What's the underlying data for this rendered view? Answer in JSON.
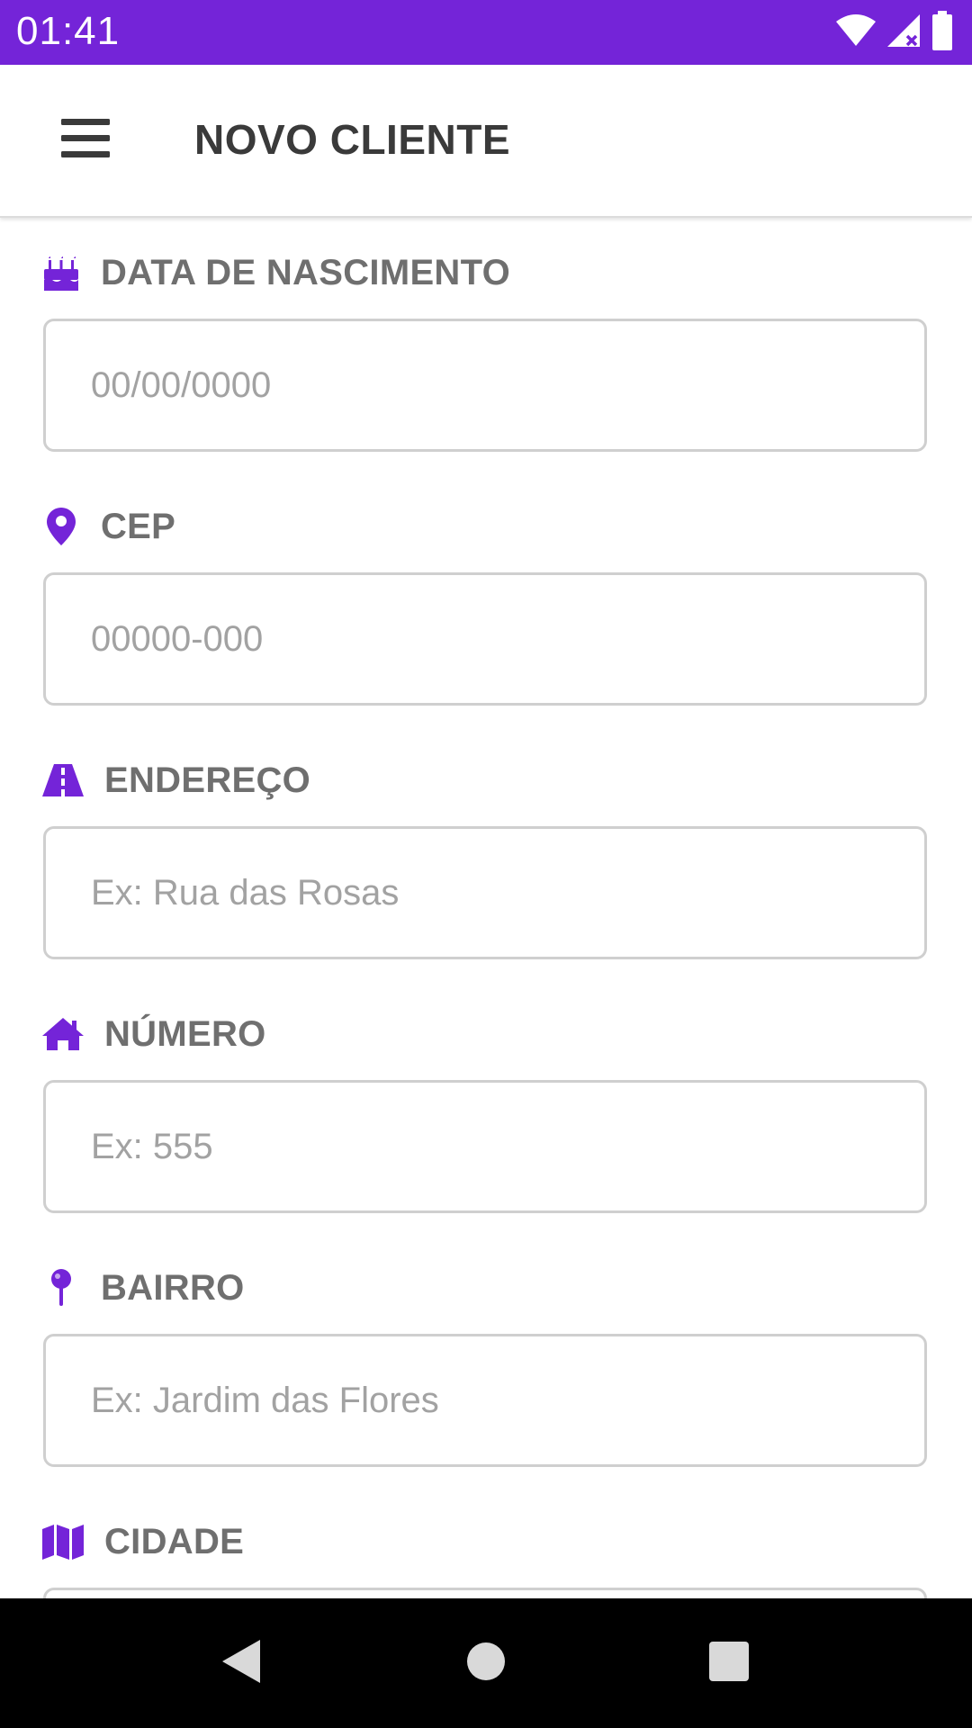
{
  "status_bar": {
    "time": "01:41",
    "background": "#7424d8",
    "icons": [
      "wifi-icon",
      "signal-icon",
      "battery-icon"
    ]
  },
  "app_bar": {
    "title": "NOVO CLIENTE",
    "menu_icon": "hamburger-menu-icon"
  },
  "accent_color": "#7424d8",
  "form": {
    "fields": [
      {
        "label": "DATA DE NASCIMENTO",
        "icon": "birthday-cake-icon",
        "placeholder": "00/00/0000",
        "value": ""
      },
      {
        "label": "CEP",
        "icon": "map-marker-icon",
        "placeholder": "00000-000",
        "value": ""
      },
      {
        "label": "ENDEREÇO",
        "icon": "road-icon",
        "placeholder": "Ex: Rua das Rosas",
        "value": ""
      },
      {
        "label": "NÚMERO",
        "icon": "home-icon",
        "placeholder": "Ex: 555",
        "value": ""
      },
      {
        "label": "BAIRRO",
        "icon": "map-pin-icon",
        "placeholder": "Ex: Jardim das Flores",
        "value": ""
      },
      {
        "label": "CIDADE",
        "icon": "map-icon",
        "placeholder": "",
        "value": ""
      }
    ]
  },
  "nav_bar": {
    "buttons": [
      "back-icon",
      "home-circle-icon",
      "recents-icon"
    ]
  }
}
